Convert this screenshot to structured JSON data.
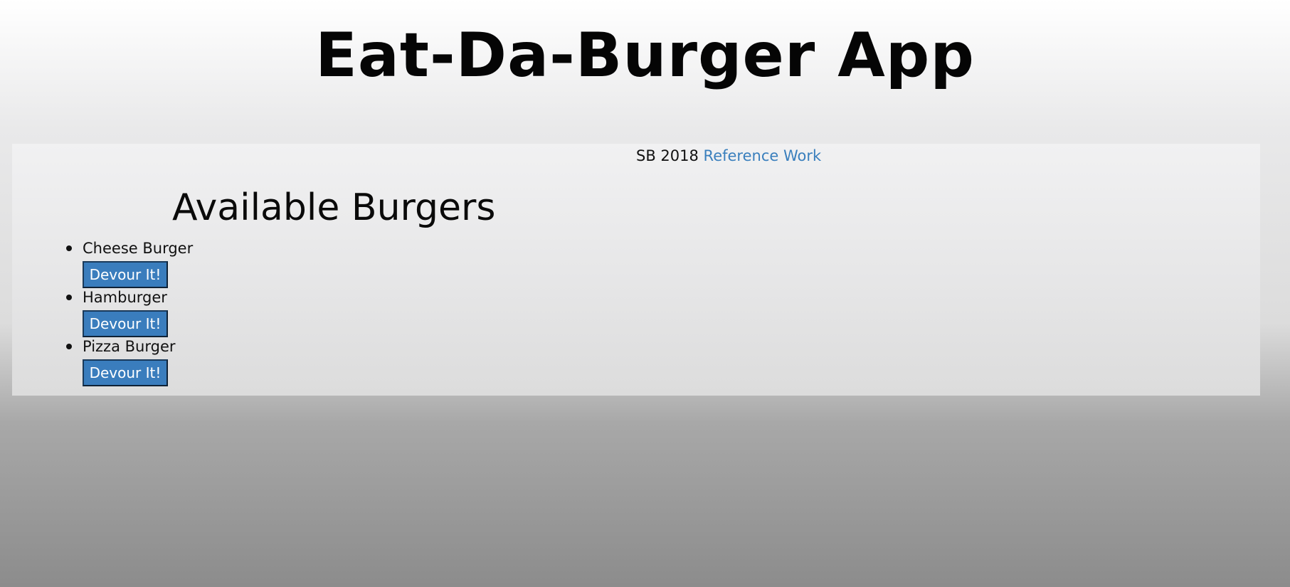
{
  "header": {
    "title": "Eat-Da-Burger App"
  },
  "credit": {
    "prefix": "SB 2018",
    "link_label": "Reference Work"
  },
  "burgers_section": {
    "title": "Available Burgers",
    "items": [
      {
        "name": "Cheese Burger",
        "button_label": "Devour It!"
      },
      {
        "name": "Hamburger",
        "button_label": "Devour It!"
      },
      {
        "name": "Pizza Burger",
        "button_label": "Devour It!"
      }
    ]
  },
  "colors": {
    "link": "#3a7fbd",
    "button_bg": "#3a7dbd",
    "button_text": "#ffffff"
  }
}
